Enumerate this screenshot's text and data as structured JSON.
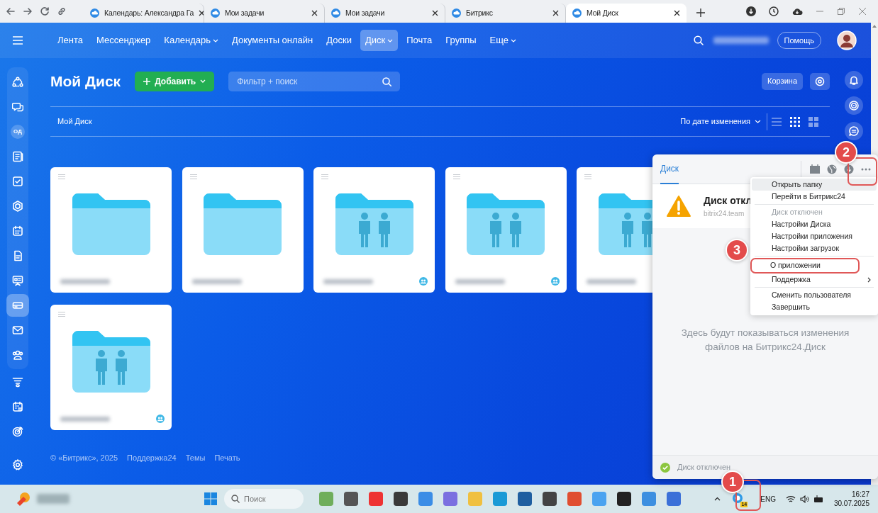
{
  "browser": {
    "tabs": [
      {
        "title": "Календарь: Александра Га",
        "selected": false
      },
      {
        "title": "Мои задачи",
        "selected": false
      },
      {
        "title": "Мои задачи",
        "selected": false
      },
      {
        "title": "Битрикс",
        "selected": false
      },
      {
        "title": "Мой Диск",
        "selected": true
      }
    ]
  },
  "top_nav": {
    "items": [
      {
        "label": "Лента",
        "selected": false,
        "dropdown": false
      },
      {
        "label": "Мессенджер",
        "selected": false,
        "dropdown": false
      },
      {
        "label": "Календарь",
        "selected": false,
        "dropdown": true
      },
      {
        "label": "Документы онлайн",
        "selected": false,
        "dropdown": false
      },
      {
        "label": "Доски",
        "selected": false,
        "dropdown": false
      },
      {
        "label": "Диск",
        "selected": true,
        "dropdown": true
      },
      {
        "label": "Почта",
        "selected": false,
        "dropdown": false
      },
      {
        "label": "Группы",
        "selected": false,
        "dropdown": false
      },
      {
        "label": "Еще",
        "selected": false,
        "dropdown": true
      }
    ],
    "help_button": "Помощь"
  },
  "sidebar": {
    "items": [
      {
        "selected": false
      },
      {
        "selected": false
      },
      {
        "selected": false,
        "label": "ОД"
      },
      {
        "selected": false
      },
      {
        "selected": false
      },
      {
        "selected": false
      },
      {
        "selected": false
      },
      {
        "selected": false
      },
      {
        "selected": false
      },
      {
        "selected": true
      },
      {
        "selected": false
      },
      {
        "selected": false
      },
      {
        "selected": false
      },
      {
        "selected": false
      },
      {
        "selected": false
      }
    ]
  },
  "content": {
    "title": "Мой Диск",
    "add_button": "Добавить",
    "filter": {
      "placeholder": "Фильтр + поиск"
    },
    "trash_button": "Корзина",
    "breadcrumb": "Мой Диск",
    "sort": "По дате изменения",
    "view_modes": [
      {
        "selected": false
      },
      {
        "selected": true
      },
      {
        "selected": false
      }
    ],
    "folders": [
      {
        "shared": false
      },
      {
        "shared": false
      },
      {
        "shared": true
      },
      {
        "shared": true
      },
      {
        "shared": true
      },
      {
        "shared": true
      }
    ]
  },
  "footer": {
    "copyright": "© «Битрикс», 2025",
    "links": [
      "Поддержка24",
      "Темы",
      "Печать"
    ]
  },
  "disk_panel": {
    "tab": "Диск",
    "status_title": "Диск откл",
    "host": "bitrix24.team",
    "empty_message": "Здесь будут показываться изменения файлов на Битрикс24.Диск",
    "footer_status": "Диск отключен"
  },
  "menu": {
    "items": [
      {
        "kind": "item",
        "label": "Открыть папку",
        "selected": true,
        "annotated": false
      },
      {
        "kind": "item",
        "label": "Перейти в Битрикс24",
        "selected": false,
        "annotated": false
      },
      {
        "kind": "divider"
      },
      {
        "kind": "disabled",
        "label": "Диск отключен",
        "selected": false,
        "annotated": false
      },
      {
        "kind": "item",
        "label": "Настройки Диска",
        "selected": false,
        "annotated": false
      },
      {
        "kind": "item",
        "label": "Настройки приложения",
        "selected": false,
        "annotated": false
      },
      {
        "kind": "item",
        "label": "Настройки загрузок",
        "selected": false,
        "annotated": false
      },
      {
        "kind": "divider"
      },
      {
        "kind": "item",
        "label": "О приложении",
        "selected": false,
        "annotated": true
      },
      {
        "kind": "submenu",
        "label": "Поддержка",
        "selected": false,
        "annotated": false
      },
      {
        "kind": "divider"
      },
      {
        "kind": "item",
        "label": "Сменить пользователя",
        "selected": false,
        "annotated": false
      },
      {
        "kind": "item",
        "label": "Завершить",
        "selected": false,
        "annotated": false
      }
    ]
  },
  "annotations": [
    {
      "number": "1"
    },
    {
      "number": "2"
    },
    {
      "number": "3"
    }
  ],
  "taskbar": {
    "search_placeholder": "Поиск",
    "language": "ENG",
    "tray_badge": "14",
    "time": "16:27",
    "date": "30.07.2025"
  }
}
